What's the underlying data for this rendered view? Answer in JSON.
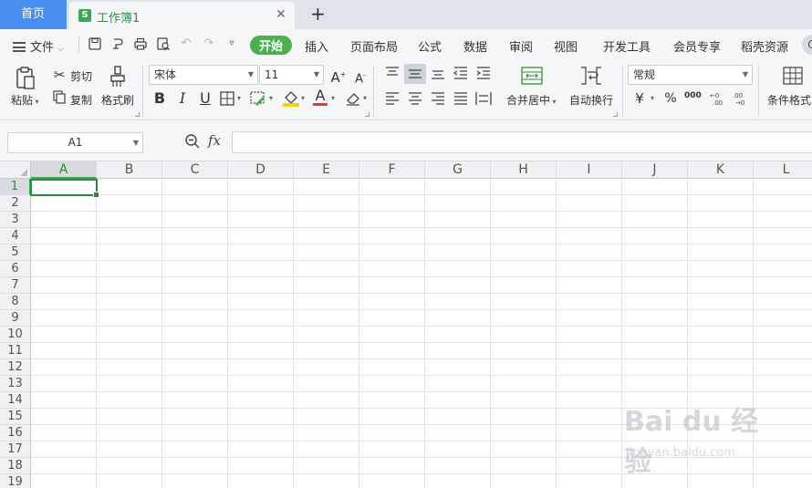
{
  "tabbar": {
    "home_label": "首页",
    "doc_badge": "S",
    "doc_label": "工作簿1",
    "close_glyph": "✕",
    "add_glyph": "+"
  },
  "menubar": {
    "file_label": "文件",
    "tabs": [
      {
        "label": "开始",
        "active": true
      },
      {
        "label": "插入"
      },
      {
        "label": "页面布局"
      },
      {
        "label": "公式"
      },
      {
        "label": "数据"
      },
      {
        "label": "审阅"
      },
      {
        "label": "视图"
      },
      {
        "label": "开发工具"
      },
      {
        "label": "会员专享"
      },
      {
        "label": "稻壳资源"
      }
    ]
  },
  "ribbon": {
    "paste_label": "粘贴",
    "cut_label": "剪切",
    "copy_label": "复制",
    "format_painter_label": "格式刷",
    "font_name": "宋体",
    "font_size": "11",
    "merge_label": "合并居中",
    "wrap_label": "自动换行",
    "number_format": "常规",
    "conditional_label": "条件格式",
    "bold_glyph": "B",
    "italic_glyph": "I",
    "underline_glyph": "U",
    "font_color_glyph": "A",
    "currency_glyph": "¥",
    "percent_glyph": "%",
    "thousands_glyph": "000"
  },
  "formula_bar": {
    "cell_ref": "A1",
    "fx_label": "fx",
    "formula": ""
  },
  "grid": {
    "columns": [
      "A",
      "B",
      "C",
      "D",
      "E",
      "F",
      "G",
      "H",
      "I",
      "J",
      "K",
      "L"
    ],
    "rows": [
      "1",
      "2",
      "3",
      "4",
      "5",
      "6",
      "7",
      "8",
      "9",
      "10",
      "11",
      "12",
      "13",
      "14",
      "15",
      "16",
      "17",
      "18",
      "19"
    ],
    "selected_column": "A",
    "selected_row": "1"
  },
  "watermark": {
    "logo": "Bai du 经验",
    "url": "jingyan.baidu.com"
  },
  "colors": {
    "accent_green": "#4caf50",
    "home_tab_blue": "#4a8ef0",
    "selection_green": "#2e8b3e"
  }
}
